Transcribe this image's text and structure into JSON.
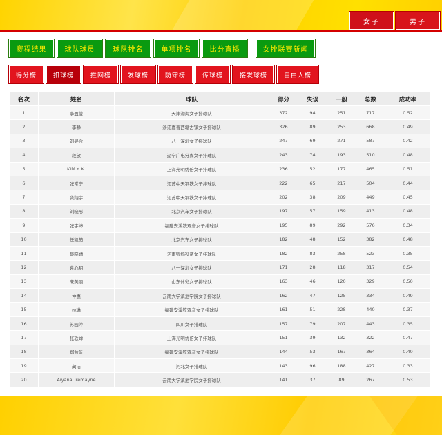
{
  "gender_tabs": [
    "女子",
    "男子"
  ],
  "nav_main": [
    "赛程结果",
    "球队球员",
    "球队排名",
    "单项排名",
    "比分直播",
    "女排联赛新闻"
  ],
  "nav_stats": [
    "得分榜",
    "扣球榜",
    "拦网榜",
    "发球榜",
    "防守榜",
    "传球榜",
    "接发球榜",
    "自由人榜"
  ],
  "active_stat_tab": "扣球榜",
  "table": {
    "headers": [
      "名次",
      "姓名",
      "球队",
      "得分",
      "失误",
      "一般",
      "总数",
      "成功率"
    ],
    "rows": [
      [
        "1",
        "李盈莹",
        "天津渤海女子排球队",
        "372",
        "94",
        "251",
        "717",
        "0.52"
      ],
      [
        "2",
        "李静",
        "浙江嘉善西塘古镇女子排球队",
        "326",
        "89",
        "253",
        "668",
        "0.49"
      ],
      [
        "3",
        "刘晏含",
        "八一深圳女子排球队",
        "247",
        "69",
        "271",
        "587",
        "0.42"
      ],
      [
        "4",
        "段放",
        "辽宁广电分离女子排球队",
        "243",
        "74",
        "193",
        "510",
        "0.48"
      ],
      [
        "5",
        "KIM Y. K.",
        "上海光明优倍女子排球队",
        "236",
        "52",
        "177",
        "465",
        "0.51"
      ],
      [
        "6",
        "张常宁",
        "江苏中天钢铁女子排球队",
        "222",
        "65",
        "217",
        "504",
        "0.44"
      ],
      [
        "7",
        "龚翔宇",
        "江苏中天钢铁女子排球队",
        "202",
        "38",
        "209",
        "449",
        "0.45"
      ],
      [
        "8",
        "刘晓彤",
        "北京汽车女子排球队",
        "197",
        "57",
        "159",
        "413",
        "0.48"
      ],
      [
        "9",
        "张宇婷",
        "福建安溪铁观音女子排球队",
        "195",
        "89",
        "292",
        "576",
        "0.34"
      ],
      [
        "10",
        "任凯茹",
        "北京汽车女子排球队",
        "182",
        "48",
        "152",
        "382",
        "0.48"
      ],
      [
        "11",
        "蔡晓婧",
        "河南银鸽投资女子排球队",
        "182",
        "83",
        "258",
        "523",
        "0.35"
      ],
      [
        "12",
        "袁心玥",
        "八一深圳女子排球队",
        "171",
        "28",
        "118",
        "317",
        "0.54"
      ],
      [
        "13",
        "宋美丽",
        "山东体彩女子排球队",
        "163",
        "46",
        "120",
        "329",
        "0.50"
      ],
      [
        "14",
        "仲惠",
        "云南大学滇池学院女子排球队",
        "162",
        "47",
        "125",
        "334",
        "0.49"
      ],
      [
        "15",
        "林琳",
        "福建安溪铁观音女子排球队",
        "161",
        "51",
        "228",
        "440",
        "0.37"
      ],
      [
        "16",
        "苏园萍",
        "四川女子排球队",
        "157",
        "79",
        "207",
        "443",
        "0.35"
      ],
      [
        "17",
        "张轶婵",
        "上海光明优倍女子排球队",
        "151",
        "39",
        "132",
        "322",
        "0.47"
      ],
      [
        "18",
        "郑益昕",
        "福建安溪铁观音女子排球队",
        "144",
        "53",
        "167",
        "364",
        "0.40"
      ],
      [
        "19",
        "蔺洁",
        "河北女子排球队",
        "143",
        "96",
        "188",
        "427",
        "0.33"
      ],
      [
        "20",
        "Aiyana Tremayne",
        "云南大学滇池学院女子排球队",
        "141",
        "37",
        "89",
        "267",
        "0.53"
      ]
    ]
  }
}
